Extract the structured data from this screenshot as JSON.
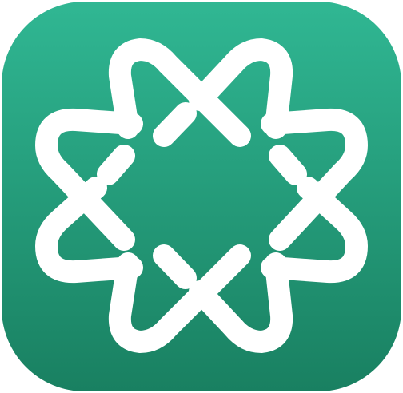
{
  "icon": {
    "name": "interlaced-star-knot-app-icon",
    "colors": {
      "gradient_top": "#30B793",
      "gradient_bottom": "#198061",
      "mark": "#FFFFFF"
    }
  }
}
